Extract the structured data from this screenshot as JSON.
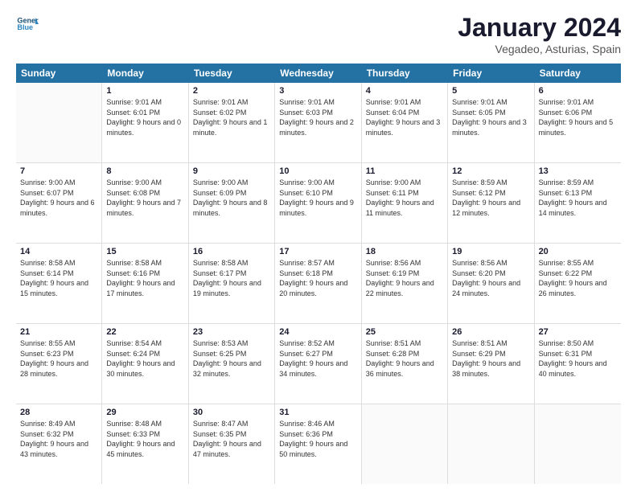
{
  "header": {
    "logo_general": "General",
    "logo_blue": "Blue",
    "month_title": "January 2024",
    "location": "Vegadeo, Asturias, Spain"
  },
  "days_of_week": [
    "Sunday",
    "Monday",
    "Tuesday",
    "Wednesday",
    "Thursday",
    "Friday",
    "Saturday"
  ],
  "weeks": [
    [
      {
        "day": "",
        "empty": true
      },
      {
        "day": "1",
        "sunrise": "Sunrise: 9:01 AM",
        "sunset": "Sunset: 6:01 PM",
        "daylight": "Daylight: 9 hours and 0 minutes."
      },
      {
        "day": "2",
        "sunrise": "Sunrise: 9:01 AM",
        "sunset": "Sunset: 6:02 PM",
        "daylight": "Daylight: 9 hours and 1 minute."
      },
      {
        "day": "3",
        "sunrise": "Sunrise: 9:01 AM",
        "sunset": "Sunset: 6:03 PM",
        "daylight": "Daylight: 9 hours and 2 minutes."
      },
      {
        "day": "4",
        "sunrise": "Sunrise: 9:01 AM",
        "sunset": "Sunset: 6:04 PM",
        "daylight": "Daylight: 9 hours and 3 minutes."
      },
      {
        "day": "5",
        "sunrise": "Sunrise: 9:01 AM",
        "sunset": "Sunset: 6:05 PM",
        "daylight": "Daylight: 9 hours and 3 minutes."
      },
      {
        "day": "6",
        "sunrise": "Sunrise: 9:01 AM",
        "sunset": "Sunset: 6:06 PM",
        "daylight": "Daylight: 9 hours and 5 minutes."
      }
    ],
    [
      {
        "day": "7",
        "sunrise": "Sunrise: 9:00 AM",
        "sunset": "Sunset: 6:07 PM",
        "daylight": "Daylight: 9 hours and 6 minutes."
      },
      {
        "day": "8",
        "sunrise": "Sunrise: 9:00 AM",
        "sunset": "Sunset: 6:08 PM",
        "daylight": "Daylight: 9 hours and 7 minutes."
      },
      {
        "day": "9",
        "sunrise": "Sunrise: 9:00 AM",
        "sunset": "Sunset: 6:09 PM",
        "daylight": "Daylight: 9 hours and 8 minutes."
      },
      {
        "day": "10",
        "sunrise": "Sunrise: 9:00 AM",
        "sunset": "Sunset: 6:10 PM",
        "daylight": "Daylight: 9 hours and 9 minutes."
      },
      {
        "day": "11",
        "sunrise": "Sunrise: 9:00 AM",
        "sunset": "Sunset: 6:11 PM",
        "daylight": "Daylight: 9 hours and 11 minutes."
      },
      {
        "day": "12",
        "sunrise": "Sunrise: 8:59 AM",
        "sunset": "Sunset: 6:12 PM",
        "daylight": "Daylight: 9 hours and 12 minutes."
      },
      {
        "day": "13",
        "sunrise": "Sunrise: 8:59 AM",
        "sunset": "Sunset: 6:13 PM",
        "daylight": "Daylight: 9 hours and 14 minutes."
      }
    ],
    [
      {
        "day": "14",
        "sunrise": "Sunrise: 8:58 AM",
        "sunset": "Sunset: 6:14 PM",
        "daylight": "Daylight: 9 hours and 15 minutes."
      },
      {
        "day": "15",
        "sunrise": "Sunrise: 8:58 AM",
        "sunset": "Sunset: 6:16 PM",
        "daylight": "Daylight: 9 hours and 17 minutes."
      },
      {
        "day": "16",
        "sunrise": "Sunrise: 8:58 AM",
        "sunset": "Sunset: 6:17 PM",
        "daylight": "Daylight: 9 hours and 19 minutes."
      },
      {
        "day": "17",
        "sunrise": "Sunrise: 8:57 AM",
        "sunset": "Sunset: 6:18 PM",
        "daylight": "Daylight: 9 hours and 20 minutes."
      },
      {
        "day": "18",
        "sunrise": "Sunrise: 8:56 AM",
        "sunset": "Sunset: 6:19 PM",
        "daylight": "Daylight: 9 hours and 22 minutes."
      },
      {
        "day": "19",
        "sunrise": "Sunrise: 8:56 AM",
        "sunset": "Sunset: 6:20 PM",
        "daylight": "Daylight: 9 hours and 24 minutes."
      },
      {
        "day": "20",
        "sunrise": "Sunrise: 8:55 AM",
        "sunset": "Sunset: 6:22 PM",
        "daylight": "Daylight: 9 hours and 26 minutes."
      }
    ],
    [
      {
        "day": "21",
        "sunrise": "Sunrise: 8:55 AM",
        "sunset": "Sunset: 6:23 PM",
        "daylight": "Daylight: 9 hours and 28 minutes."
      },
      {
        "day": "22",
        "sunrise": "Sunrise: 8:54 AM",
        "sunset": "Sunset: 6:24 PM",
        "daylight": "Daylight: 9 hours and 30 minutes."
      },
      {
        "day": "23",
        "sunrise": "Sunrise: 8:53 AM",
        "sunset": "Sunset: 6:25 PM",
        "daylight": "Daylight: 9 hours and 32 minutes."
      },
      {
        "day": "24",
        "sunrise": "Sunrise: 8:52 AM",
        "sunset": "Sunset: 6:27 PM",
        "daylight": "Daylight: 9 hours and 34 minutes."
      },
      {
        "day": "25",
        "sunrise": "Sunrise: 8:51 AM",
        "sunset": "Sunset: 6:28 PM",
        "daylight": "Daylight: 9 hours and 36 minutes."
      },
      {
        "day": "26",
        "sunrise": "Sunrise: 8:51 AM",
        "sunset": "Sunset: 6:29 PM",
        "daylight": "Daylight: 9 hours and 38 minutes."
      },
      {
        "day": "27",
        "sunrise": "Sunrise: 8:50 AM",
        "sunset": "Sunset: 6:31 PM",
        "daylight": "Daylight: 9 hours and 40 minutes."
      }
    ],
    [
      {
        "day": "28",
        "sunrise": "Sunrise: 8:49 AM",
        "sunset": "Sunset: 6:32 PM",
        "daylight": "Daylight: 9 hours and 43 minutes."
      },
      {
        "day": "29",
        "sunrise": "Sunrise: 8:48 AM",
        "sunset": "Sunset: 6:33 PM",
        "daylight": "Daylight: 9 hours and 45 minutes."
      },
      {
        "day": "30",
        "sunrise": "Sunrise: 8:47 AM",
        "sunset": "Sunset: 6:35 PM",
        "daylight": "Daylight: 9 hours and 47 minutes."
      },
      {
        "day": "31",
        "sunrise": "Sunrise: 8:46 AM",
        "sunset": "Sunset: 6:36 PM",
        "daylight": "Daylight: 9 hours and 50 minutes."
      },
      {
        "day": "",
        "empty": true
      },
      {
        "day": "",
        "empty": true
      },
      {
        "day": "",
        "empty": true
      }
    ]
  ]
}
